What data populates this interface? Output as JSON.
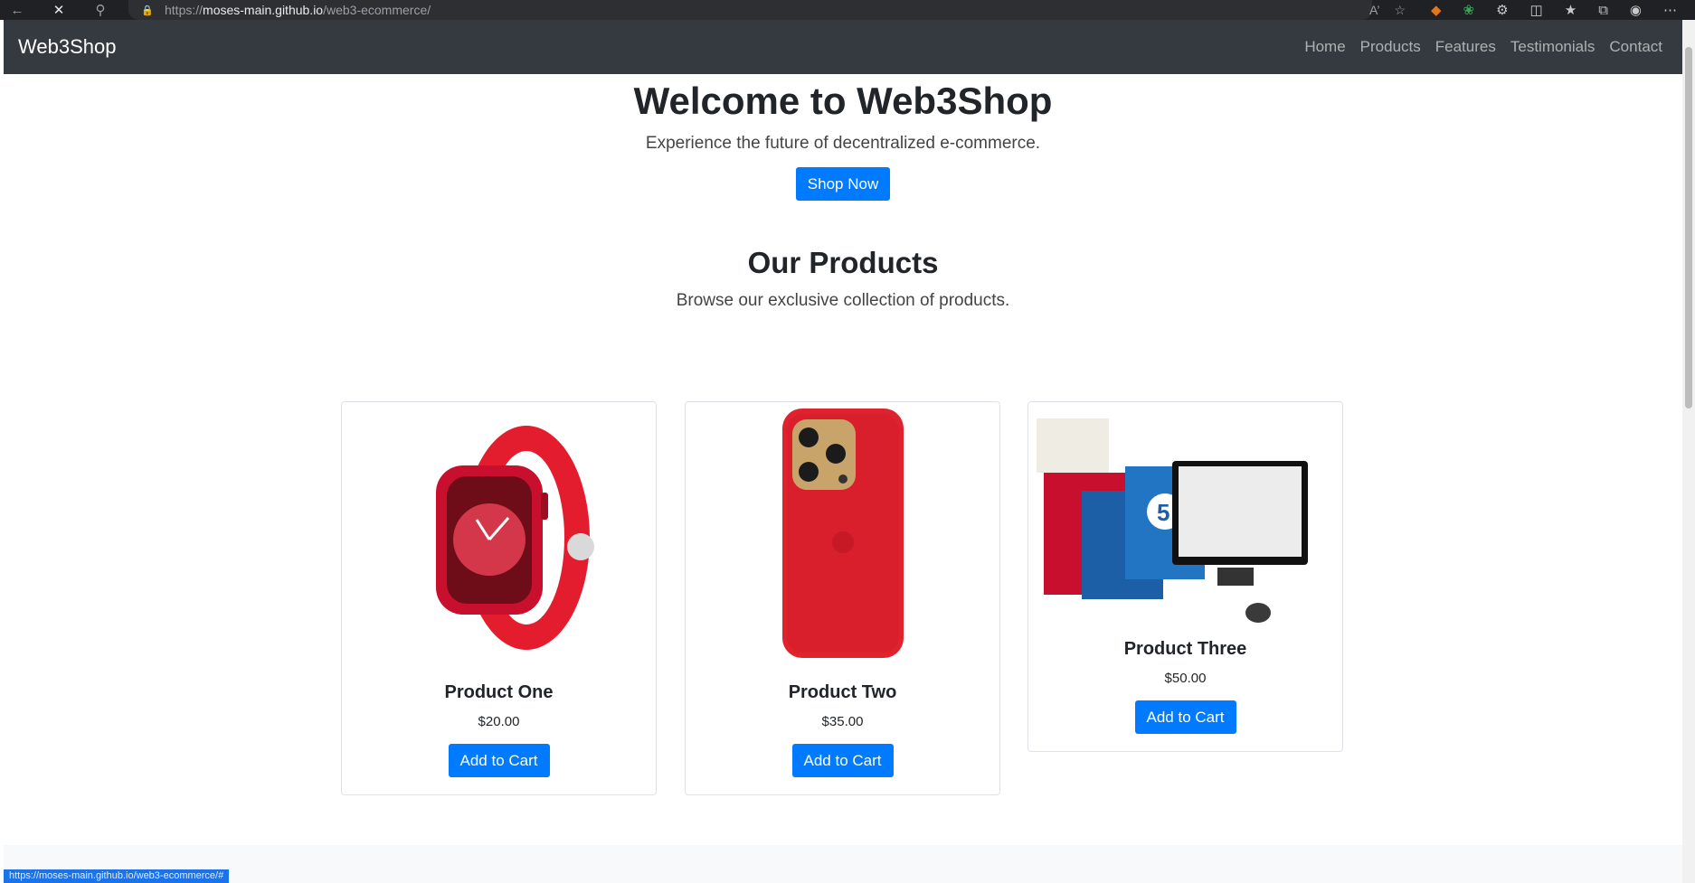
{
  "browser": {
    "url_prefix": "https://",
    "url_domain": "moses-main.github.io",
    "url_path": "/web3-ecommerce/",
    "status_url": "https://moses-main.github.io/web3-ecommerce/#",
    "icons": [
      "back-icon",
      "close-icon",
      "search-icon",
      "lock-icon",
      "read-aloud-icon",
      "favorite-star-icon",
      "metamask-icon",
      "extension-leaf-icon",
      "extensions-icon",
      "split-screen-icon",
      "favorites-icon",
      "collections-icon",
      "profile-icon",
      "more-icon"
    ]
  },
  "navbar": {
    "brand": "Web3Shop",
    "links": [
      "Home",
      "Products",
      "Features",
      "Testimonials",
      "Contact"
    ]
  },
  "hero": {
    "title": "Welcome to Web3Shop",
    "subtitle": "Experience the future of decentralized e-commerce.",
    "button": "Shop Now"
  },
  "products": {
    "title": "Our Products",
    "subtitle": "Browse our exclusive collection of products.",
    "items": [
      {
        "name": "Product One",
        "price": "$20.00",
        "button": "Add to Cart",
        "image": "red-smartwatch"
      },
      {
        "name": "Product Two",
        "price": "$35.00",
        "button": "Add to Cart",
        "image": "red-phone-case"
      },
      {
        "name": "Product Three",
        "price": "$50.00",
        "button": "Add to Cart",
        "image": "shopping-bags-monitor"
      }
    ]
  },
  "colors": {
    "primary": "#007bff",
    "navbar": "#343a40",
    "text": "#212529"
  }
}
